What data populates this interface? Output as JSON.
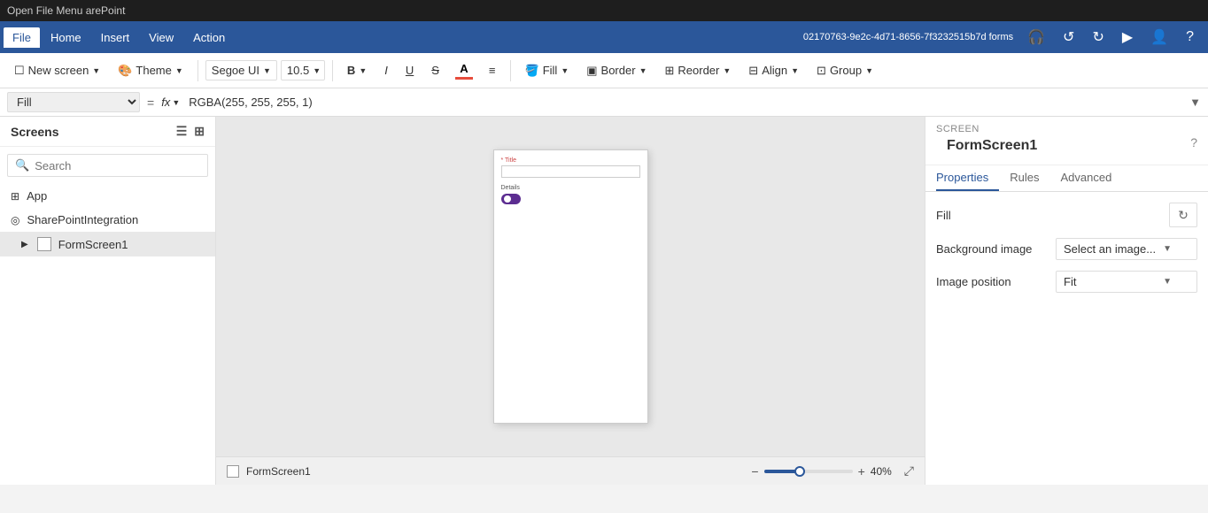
{
  "titleBar": {
    "text": "Open File Menu  arePoint"
  },
  "menuBar": {
    "items": [
      {
        "id": "file",
        "label": "File",
        "active": true
      },
      {
        "id": "home",
        "label": "Home",
        "active": false
      },
      {
        "id": "insert",
        "label": "Insert",
        "active": false
      },
      {
        "id": "view",
        "label": "View",
        "active": false
      },
      {
        "id": "action",
        "label": "Action",
        "active": false
      }
    ],
    "appId": "02170763-9e2c-4d71-8656-7f3232515b7d forms"
  },
  "toolbar": {
    "newScreenLabel": "New screen",
    "themeLabel": "Theme",
    "fontFamily": "Segoe UI",
    "fontSize": "10.5",
    "boldLabel": "B",
    "italicLabel": "I",
    "underlineLabel": "U",
    "strikeLabel": "S",
    "colorLabel": "A",
    "alignLabel": "≡",
    "fillLabel": "Fill",
    "borderLabel": "Border",
    "reorderLabel": "Reorder",
    "alignMenuLabel": "Align",
    "groupLabel": "Group"
  },
  "formulaBar": {
    "property": "Fill",
    "equals": "=",
    "fx": "fx",
    "formula": "RGBA(255, 255, 255, 1)"
  },
  "sidebar": {
    "title": "Screens",
    "searchPlaceholder": "Search",
    "items": [
      {
        "id": "app",
        "label": "App",
        "icon": "app-icon",
        "indent": false
      },
      {
        "id": "sharepoint",
        "label": "SharePointIntegration",
        "icon": "sharepoint-icon",
        "indent": false
      },
      {
        "id": "formscreen1",
        "label": "FormScreen1",
        "icon": "screen-icon",
        "indent": true,
        "active": true
      }
    ]
  },
  "canvas": {
    "screenLabel": "FormScreen1",
    "zoomPercent": "40",
    "zoomSymbol": "%",
    "phoneTitleLabel": "* Title",
    "phoneDetailsLabel": "Details"
  },
  "rightPanel": {
    "sectionLabel": "SCREEN",
    "title": "FormScreen1",
    "tabs": [
      {
        "id": "properties",
        "label": "Properties",
        "active": true
      },
      {
        "id": "rules",
        "label": "Rules",
        "active": false
      },
      {
        "id": "advanced",
        "label": "Advanced",
        "active": false
      }
    ],
    "fillLabel": "Fill",
    "backgroundImageLabel": "Background image",
    "backgroundImageValue": "Select an image...",
    "imagePositionLabel": "Image position",
    "imagePositionValue": "Fit"
  }
}
